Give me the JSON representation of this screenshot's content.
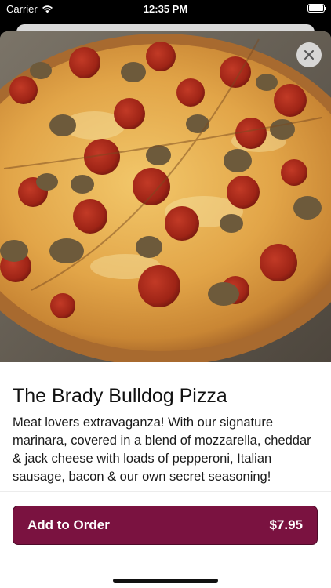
{
  "status_bar": {
    "carrier": "Carrier",
    "time": "12:35 PM",
    "wifi_icon": "wifi-icon",
    "battery_icon": "battery-icon"
  },
  "hero": {
    "image": "pizza-photo",
    "close_icon": "close-icon"
  },
  "item": {
    "title": "The Brady Bulldog Pizza",
    "description": "Meat lovers extravaganza! With our signature marinara, covered in a blend of mozzarella, cheddar & jack cheese with loads of pepperoni, Italian sausage, bacon & our own secret seasoning!"
  },
  "order_button": {
    "label": "Add to Order",
    "price": "$7.95"
  },
  "colors": {
    "accent": "#7a1240"
  }
}
